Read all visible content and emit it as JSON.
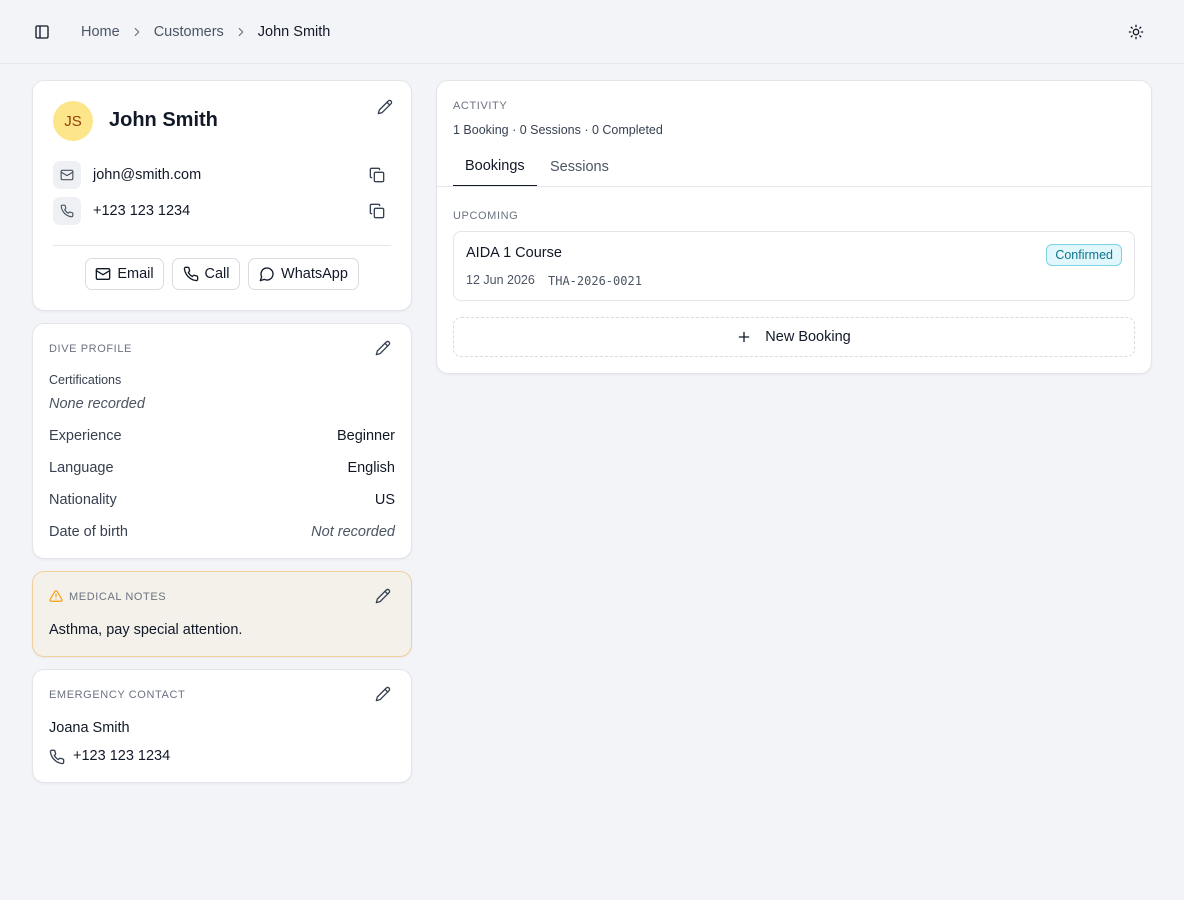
{
  "breadcrumb": {
    "home": "Home",
    "customers": "Customers",
    "current": "John Smith"
  },
  "profile": {
    "initials": "JS",
    "name": "John Smith",
    "email": "john@smith.com",
    "phone": "+123 123 1234",
    "actions": {
      "email": "Email",
      "call": "Call",
      "whatsapp": "WhatsApp"
    }
  },
  "dive_profile": {
    "title": "Dive Profile",
    "certifications_label": "Certifications",
    "certifications_value": "None recorded",
    "fields": [
      {
        "label": "Experience",
        "value": "Beginner"
      },
      {
        "label": "Language",
        "value": "English"
      },
      {
        "label": "Nationality",
        "value": "US"
      },
      {
        "label": "Date of birth",
        "value": "Not recorded"
      }
    ]
  },
  "medical": {
    "title": "Medical Notes",
    "text": "Asthma, pay special attention."
  },
  "emergency": {
    "title": "Emergency Contact",
    "name": "Joana Smith",
    "phone": "+123 123 1234"
  },
  "activity": {
    "title": "Activity",
    "summary": "1 Booking · 0 Sessions · 0 Completed",
    "tabs": [
      {
        "label": "Bookings",
        "active": true
      },
      {
        "label": "Sessions",
        "active": false
      }
    ],
    "upcoming_label": "Upcoming",
    "bookings": [
      {
        "title": "AIDA 1 Course",
        "date": "12 Jun 2026",
        "reference": "THA-2026-0021",
        "status": "Confirmed"
      }
    ],
    "new_booking_label": "New Booking"
  },
  "colors": {
    "accent": "#111827",
    "avatar_bg": "#fde68a",
    "medical_bg": "#f4f1ea",
    "warning_icon": "#f59e0b",
    "confirmed_badge": "#0e7490"
  },
  "icons": {
    "sidebar_toggle": "panel-left-icon",
    "theme": "sun-icon",
    "edit": "pencil-icon",
    "copy": "copy-icon",
    "mail": "mail-icon",
    "phone": "phone-icon",
    "whatsapp": "message-circle-icon",
    "warning": "alert-triangle-icon",
    "add": "plus-icon"
  }
}
